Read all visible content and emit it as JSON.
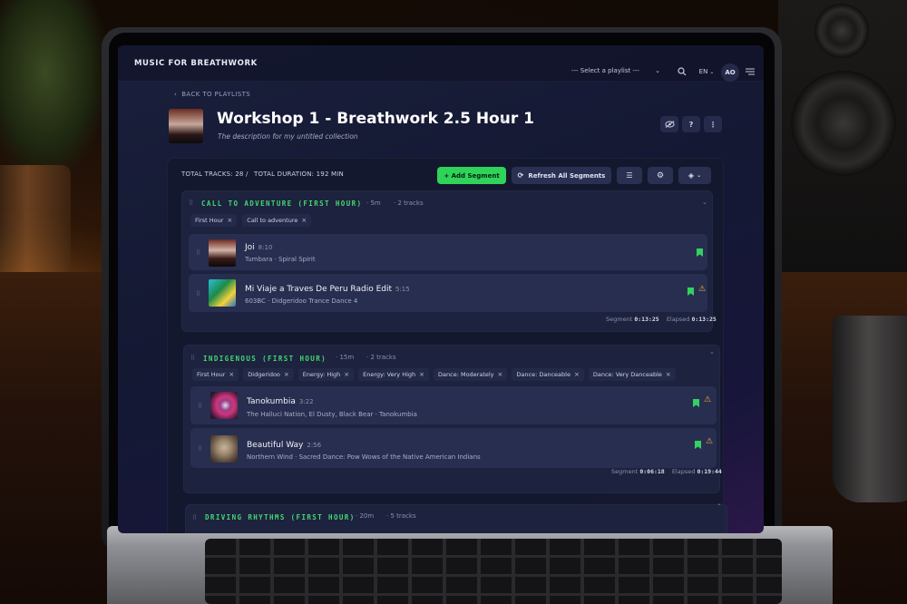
{
  "app": {
    "brand": "MUSIC FOR BREATHWORK"
  },
  "header": {
    "playlist_select": "--- Select a playlist ---",
    "language": "EN",
    "avatar_initials": "AO"
  },
  "back_link": "BACK TO PLAYLISTS",
  "playlist": {
    "title": "Workshop 1 - Breathwork 2.5 Hour 1",
    "description": "The description for my untitled collection",
    "help_label": "?",
    "more_label": "⋮"
  },
  "stats": {
    "total_tracks_label": "TOTAL TRACKS: 28 /",
    "total_duration_label": "TOTAL DURATION: 192 MIN"
  },
  "toolbar": {
    "add_segment": "+ Add Segment",
    "refresh": "Refresh All Segments"
  },
  "segments": [
    {
      "name": "CALL TO ADVENTURE (FIRST HOUR)",
      "duration": "5m",
      "tracks_count": "2 tracks",
      "tags": [
        "First Hour",
        "Call to adventure"
      ],
      "tracks": [
        {
          "title": "Joi",
          "duration": "8:10",
          "artist": "Tumbara · Spiral Spirit",
          "warning": false
        },
        {
          "title": "Mi Viaje a Traves De Peru Radio Edit",
          "duration": "5:15",
          "artist": "603BC · Didgeridoo Trance Dance 4",
          "warning": true
        }
      ],
      "segment_label": "Segment",
      "segment_time": "0:13:25",
      "elapsed_label": "Elapsed",
      "elapsed_time": "0:13:25"
    },
    {
      "name": "INDIGENOUS (FIRST HOUR)",
      "duration": "15m",
      "tracks_count": "2 tracks",
      "tags": [
        "First Hour",
        "Didgeridoo",
        "Energy: High",
        "Energy: Very High",
        "Dance: Moderately",
        "Dance: Danceable",
        "Dance: Very Danceable"
      ],
      "tracks": [
        {
          "title": "Tanokumbia",
          "duration": "3:22",
          "artist": "The Halluci Nation, El Dusty, Black Bear · Tanokumbia",
          "warning": true
        },
        {
          "title": "Beautiful Way",
          "duration": "2:56",
          "artist": "Northern Wind · Sacred Dance: Pow Wows of the Native American Indians",
          "warning": true
        }
      ],
      "segment_label": "Segment",
      "segment_time": "0:06:18",
      "elapsed_label": "Elapsed",
      "elapsed_time": "0:19:44"
    },
    {
      "name": "DRIVING RHYTHMS (FIRST HOUR)",
      "duration": "20m",
      "tracks_count": "5 tracks"
    }
  ],
  "colors": {
    "accent_green": "#2fd35a",
    "warning": "#f2b233",
    "background": "#151a36"
  }
}
